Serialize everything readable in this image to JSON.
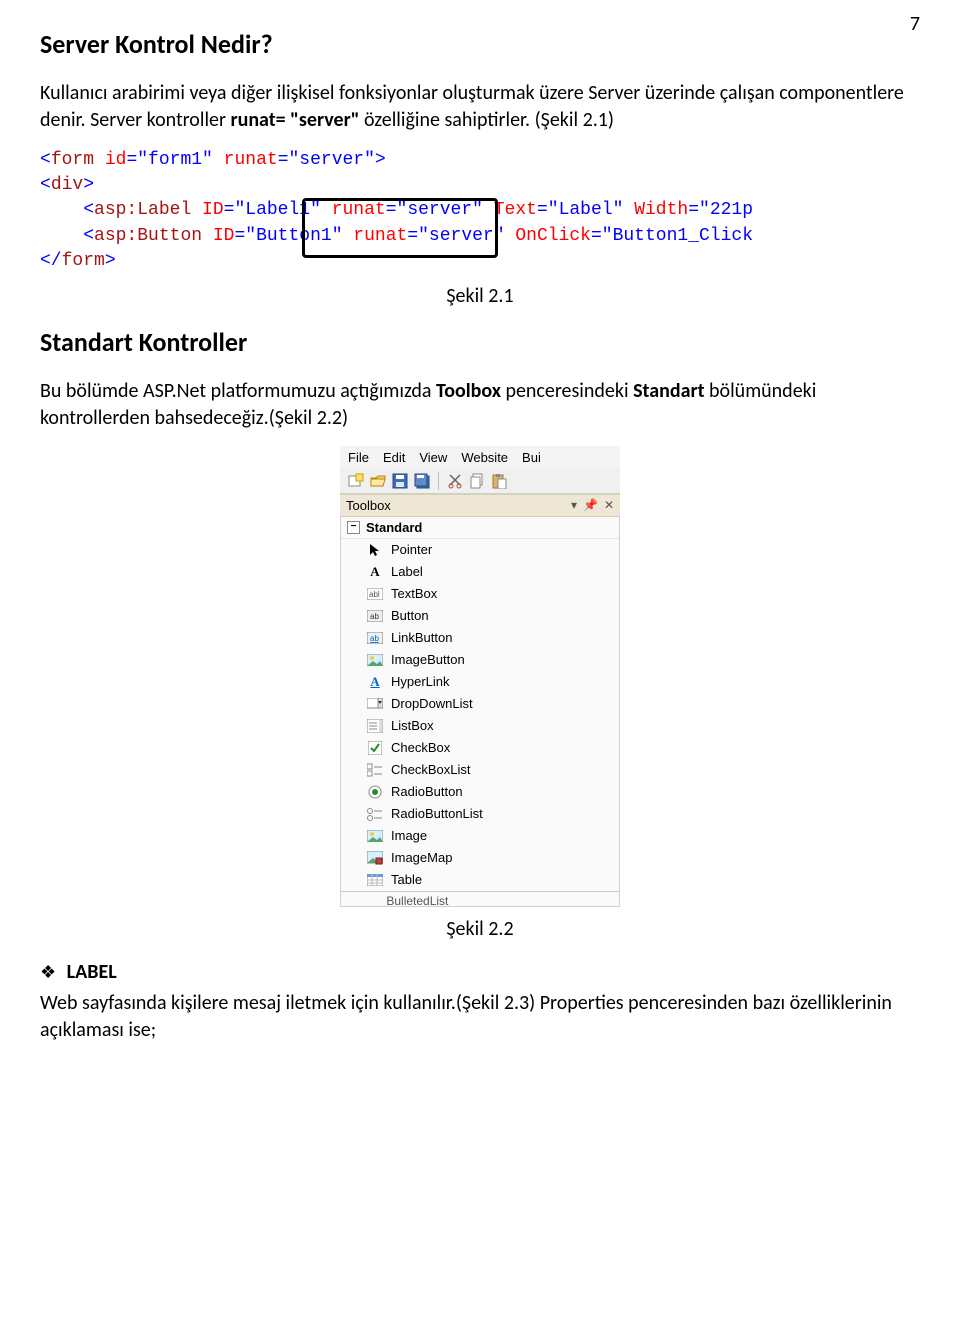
{
  "page_number": "7",
  "heading1": "Server Kontrol Nedir?",
  "p1_a": "Kullanıcı arabirimi veya diğer ilişkisel fonksiyonlar oluşturmak üzere Server üzerinde çalışan componentlere denir. Server kontroller ",
  "p1_b": "runat= \"server\"",
  "p1_c": " özelliğine sahiptirler. (Şekil 2.1)",
  "code": {
    "l1_angle": "<",
    "l1_tag": "form",
    "l1_attr_id": " id",
    "l1_eq": "=",
    "l1_val_id": "\"form1\"",
    "l1_attr_runat": " runat",
    "l1_val_runat": "\"server\"",
    "l1_close": ">",
    "l2_open": "<",
    "l2_tag": "div",
    "l2_close": ">",
    "l3_indent": "    ",
    "l3_open": "<",
    "l3_tag": "asp:Label",
    "l3_attr_id": " ID",
    "l3_val_id": "\"Label1\"",
    "l3_attr_runat": " runat",
    "l3_val_runat": "\"server\"",
    "l3_attr_text": " T",
    "l3_attr_text2": "ext",
    "l3_val_text": "\"Label\"",
    "l3_attr_width": " Width",
    "l3_val_width": "\"221p",
    "l4_indent": "    ",
    "l4_open": "<",
    "l4_tag": "asp:Button",
    "l4_attr_id": " ID",
    "l4_val_id": "\"Button1\"",
    "l4_attr_runat": " runat",
    "l4_val_runat": "\"server\"",
    "l4_attr_onclick": " OnClick",
    "l4_val_onclick": "\"Button1_Click",
    "l5_open": "</",
    "l5_tag": "form",
    "l5_close": ">"
  },
  "caption1": "Şekil 2.1",
  "heading2": "Standart Kontroller",
  "p2_a": "Bu bölümde ASP.Net platformumuzu açtığımızda ",
  "p2_b": "Toolbox",
  "p2_c": " penceresindeki ",
  "p2_d": "Standart",
  "p2_e": " bölümündeki kontrollerden bahsedeceğiz.(Şekil 2.2)",
  "vs": {
    "menu": [
      "File",
      "Edit",
      "View",
      "Website",
      "Bui"
    ],
    "panel_title": "Toolbox",
    "group": "Standard",
    "icons": {
      "pointer": "pointer-icon",
      "label": "label-a-icon",
      "textbox": "textbox-icon",
      "button": "button-icon",
      "linkbutton": "linkbutton-icon",
      "imagebutton": "imagebutton-icon",
      "hyperlink": "hyperlink-icon",
      "dropdownlist": "dropdown-icon",
      "listbox": "listbox-icon",
      "checkbox": "checkbox-icon",
      "checkboxlist": "checkboxlist-icon",
      "radiobutton": "radiobutton-icon",
      "radiobuttonlist": "radiobuttonlist-icon",
      "image": "image-icon",
      "imagemap": "imagemap-icon",
      "table": "table-icon"
    },
    "items": [
      "Pointer",
      "Label",
      "TextBox",
      "Button",
      "LinkButton",
      "ImageButton",
      "HyperLink",
      "DropDownList",
      "ListBox",
      "CheckBox",
      "CheckBoxList",
      "RadioButton",
      "RadioButtonList",
      "Image",
      "ImageMap",
      "Table"
    ],
    "cut_item": "BulletedList"
  },
  "caption2": "Şekil 2.2",
  "label_heading": "LABEL",
  "p3": "Web sayfasında kişilere mesaj iletmek için kullanılır.(Şekil 2.3) Properties penceresinden bazı özelliklerinin açıklaması ise;"
}
